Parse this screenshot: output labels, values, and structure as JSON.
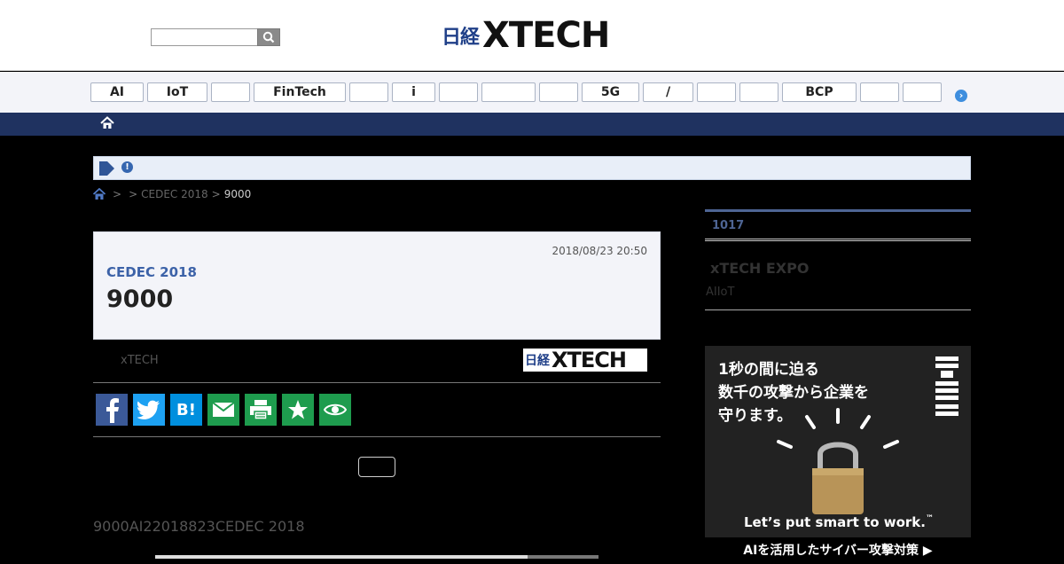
{
  "header": {
    "search_placeholder": "",
    "logo_jp": "日経",
    "logo_main": "XTECH"
  },
  "tags": [
    {
      "label": "AI"
    },
    {
      "label": "IoT"
    },
    {
      "label": ""
    },
    {
      "label": "FinTech"
    },
    {
      "label": ""
    },
    {
      "label": "i"
    },
    {
      "label": ""
    },
    {
      "label": ""
    },
    {
      "label": ""
    },
    {
      "label": "5G"
    },
    {
      "label": "/"
    },
    {
      "label": ""
    },
    {
      "label": ""
    },
    {
      "label": "BCP"
    },
    {
      "label": ""
    },
    {
      "label": ""
    }
  ],
  "breadcrumb": {
    "sep1": ">",
    "sep2": ">",
    "item2": "CEDEC 2018",
    "sep3": ">",
    "current": "9000"
  },
  "article": {
    "date": "2018/08/23 20:50",
    "kicker": "CEDEC 2018",
    "title": "9000",
    "author": "xTECH",
    "source_logo_jp": "日経",
    "source_logo_main": "XTECH",
    "body": "9000AI22018823CEDEC 2018"
  },
  "share": [
    {
      "icon": "facebook-icon",
      "color": "#3b5998"
    },
    {
      "icon": "twitter-icon",
      "color": "#1da1f2"
    },
    {
      "icon": "hatena-icon",
      "color": "#008fde",
      "label": "B!"
    },
    {
      "icon": "mail-icon",
      "color": "#1e9c4e"
    },
    {
      "icon": "print-icon",
      "color": "#1e9c4e"
    },
    {
      "icon": "star-icon",
      "color": "#1e9c4e"
    },
    {
      "icon": "eye-icon",
      "color": "#1e9c4e"
    }
  ],
  "sidebar": {
    "ranking_label": "1017",
    "expo_title": "xTECH EXPO",
    "expo_sub": "AIIoT"
  },
  "ad": {
    "line1": "1秒の間に迫る",
    "line2": "数千の攻撃から企業を",
    "line3": "守ります。",
    "tagline": "Let’s put smart to work.",
    "tagline_tm": "™",
    "footer": "AIを活用したサイバー攻撃対策 ▶"
  }
}
